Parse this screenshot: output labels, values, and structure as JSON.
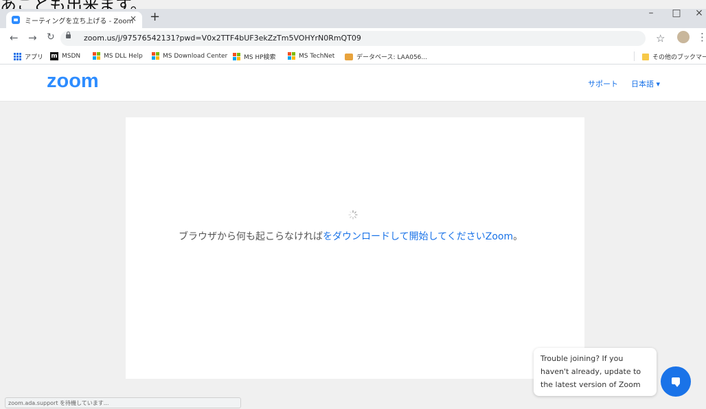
{
  "page_top_text": "あことも出来ます。",
  "browser": {
    "tab_title": "ミーティングを立ち上げる - Zoom",
    "tab_close": "×",
    "new_tab": "+",
    "window_minimize": "–",
    "window_maximize": "□",
    "window_close": "×",
    "url": "zoom.us/j/97576542131?pwd=V0x2TTF4bUF3ekZzTm5VOHYrN0RmQT09"
  },
  "bookmarks": {
    "items": [
      "アプリ",
      "MSDN",
      "MS DLL Help",
      "MS Download Center",
      "MS HP検索",
      "MS TechNet",
      "データベース: LAA056..."
    ],
    "other": "その他のブックマーク"
  },
  "zoom": {
    "logo": "zoom",
    "support_label": "サポート",
    "language_label": "日本語 ▾",
    "message_prefix": "ブラウザから何も起こらなければ",
    "message_link": "をダウンロードして開始してくださいZoom",
    "message_suffix": "。"
  },
  "chat": {
    "bubble_text": "Trouble joining? If you haven't already, update to the latest version of Zoom"
  },
  "status_bar": "zoom.ada.support を待機しています..."
}
